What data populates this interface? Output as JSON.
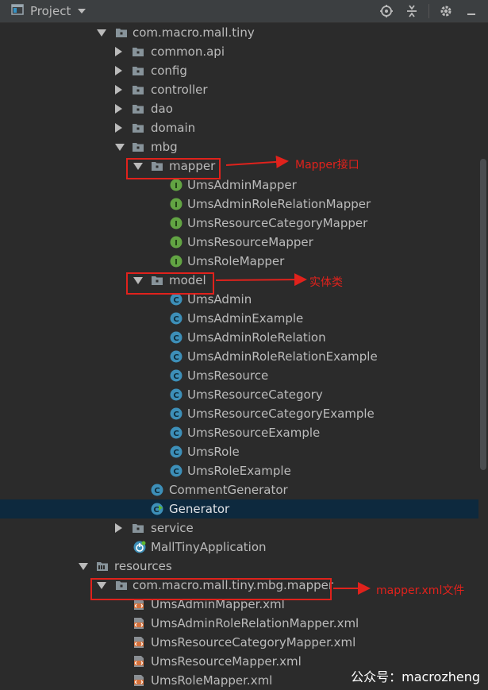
{
  "toolbar": {
    "title": "Project",
    "icons": [
      "project-window-icon",
      "dropdown-icon",
      "locate-icon",
      "collapse-all-icon",
      "settings-gear-icon",
      "hide-icon"
    ]
  },
  "tree": [
    {
      "label": "com.macro.mall.tiny",
      "icon": "package",
      "arrow": "expanded"
    },
    {
      "label": "common.api",
      "icon": "package",
      "arrow": "collapsed"
    },
    {
      "label": "config",
      "icon": "package",
      "arrow": "collapsed"
    },
    {
      "label": "controller",
      "icon": "package",
      "arrow": "collapsed"
    },
    {
      "label": "dao",
      "icon": "package",
      "arrow": "collapsed"
    },
    {
      "label": "domain",
      "icon": "package",
      "arrow": "collapsed"
    },
    {
      "label": "mbg",
      "icon": "package",
      "arrow": "expanded"
    },
    {
      "label": "mapper",
      "icon": "package",
      "arrow": "expanded"
    },
    {
      "label": "UmsAdminMapper",
      "icon": "interface"
    },
    {
      "label": "UmsAdminRoleRelationMapper",
      "icon": "interface"
    },
    {
      "label": "UmsResourceCategoryMapper",
      "icon": "interface"
    },
    {
      "label": "UmsResourceMapper",
      "icon": "interface"
    },
    {
      "label": "UmsRoleMapper",
      "icon": "interface"
    },
    {
      "label": "model",
      "icon": "package",
      "arrow": "expanded"
    },
    {
      "label": "UmsAdmin",
      "icon": "class"
    },
    {
      "label": "UmsAdminExample",
      "icon": "class"
    },
    {
      "label": "UmsAdminRoleRelation",
      "icon": "class"
    },
    {
      "label": "UmsAdminRoleRelationExample",
      "icon": "class"
    },
    {
      "label": "UmsResource",
      "icon": "class"
    },
    {
      "label": "UmsResourceCategory",
      "icon": "class"
    },
    {
      "label": "UmsResourceCategoryExample",
      "icon": "class"
    },
    {
      "label": "UmsResourceExample",
      "icon": "class"
    },
    {
      "label": "UmsRole",
      "icon": "class"
    },
    {
      "label": "UmsRoleExample",
      "icon": "class"
    },
    {
      "label": "CommentGenerator",
      "icon": "class"
    },
    {
      "label": "Generator",
      "icon": "class-runnable",
      "selected": true
    },
    {
      "label": "service",
      "icon": "package",
      "arrow": "collapsed"
    },
    {
      "label": "MallTinyApplication",
      "icon": "spring-boot-app"
    },
    {
      "label": "resources",
      "icon": "resources-folder",
      "arrow": "expanded"
    },
    {
      "label": "com.macro.mall.tiny.mbg.mapper",
      "icon": "package",
      "arrow": "expanded"
    },
    {
      "label": "UmsAdminMapper.xml",
      "icon": "xml-file"
    },
    {
      "label": "UmsAdminRoleRelationMapper.xml",
      "icon": "xml-file"
    },
    {
      "label": "UmsResourceCategoryMapper.xml",
      "icon": "xml-file"
    },
    {
      "label": "UmsResourceMapper.xml",
      "icon": "xml-file"
    },
    {
      "label": "UmsRoleMapper.xml",
      "icon": "xml-file"
    }
  ],
  "annotations": {
    "mapper_note": "Mapper接口",
    "model_note": "实体类",
    "xml_note": "mapper.xml文件",
    "color": "#e0221c"
  },
  "watermark": "公众号：macrozheng",
  "colors": {
    "background": "#2b2b2b",
    "toolbar": "#3c3f41",
    "selection": "#0d293e",
    "interface_icon": "#62a443",
    "class_icon": "#3d8fb8",
    "text": "#bbbbbb"
  }
}
